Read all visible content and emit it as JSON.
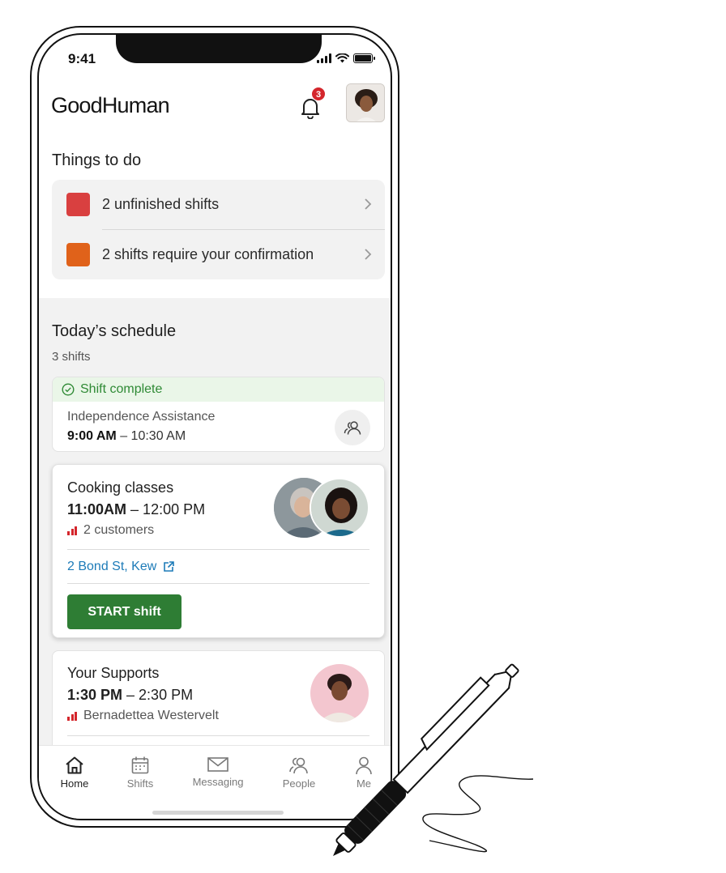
{
  "status_bar": {
    "time": "9:41"
  },
  "header": {
    "app_title": "GoodHuman",
    "notification_count": "3"
  },
  "things_to_do": {
    "title": "Things to do",
    "items": [
      {
        "label": "2 unfinished shifts",
        "color": "#d94040"
      },
      {
        "label": "2 shifts require your confirmation",
        "color": "#e0621a"
      }
    ]
  },
  "schedule": {
    "title": "Today’s schedule",
    "subtitle": "3 shifts",
    "cards": [
      {
        "status": "Shift complete",
        "service": "Independence Assistance",
        "time_start": "9:00 AM",
        "time_rest": " – 10:30 AM"
      },
      {
        "title": "Cooking classes",
        "time_start": "11:00AM",
        "time_rest": " – 12:00 PM",
        "meta": "2 customers",
        "address": "2 Bond St, Kew",
        "action": "START shift"
      },
      {
        "title": "Your Supports",
        "time_start": "1:30 PM",
        "time_rest": " – 2:30 PM",
        "meta": "Bernadettea Westervelt"
      }
    ]
  },
  "tabs": [
    {
      "label": "Home",
      "icon": "home-icon",
      "active": true
    },
    {
      "label": "Shifts",
      "icon": "calendar-icon"
    },
    {
      "label": "Messaging",
      "icon": "mail-icon"
    },
    {
      "label": "People",
      "icon": "people-icon"
    },
    {
      "label": "Me",
      "icon": "person-icon"
    }
  ],
  "colors": {
    "accent_green": "#2e7d34",
    "link_blue": "#1d7bb8",
    "alert_red": "#d4262c"
  }
}
